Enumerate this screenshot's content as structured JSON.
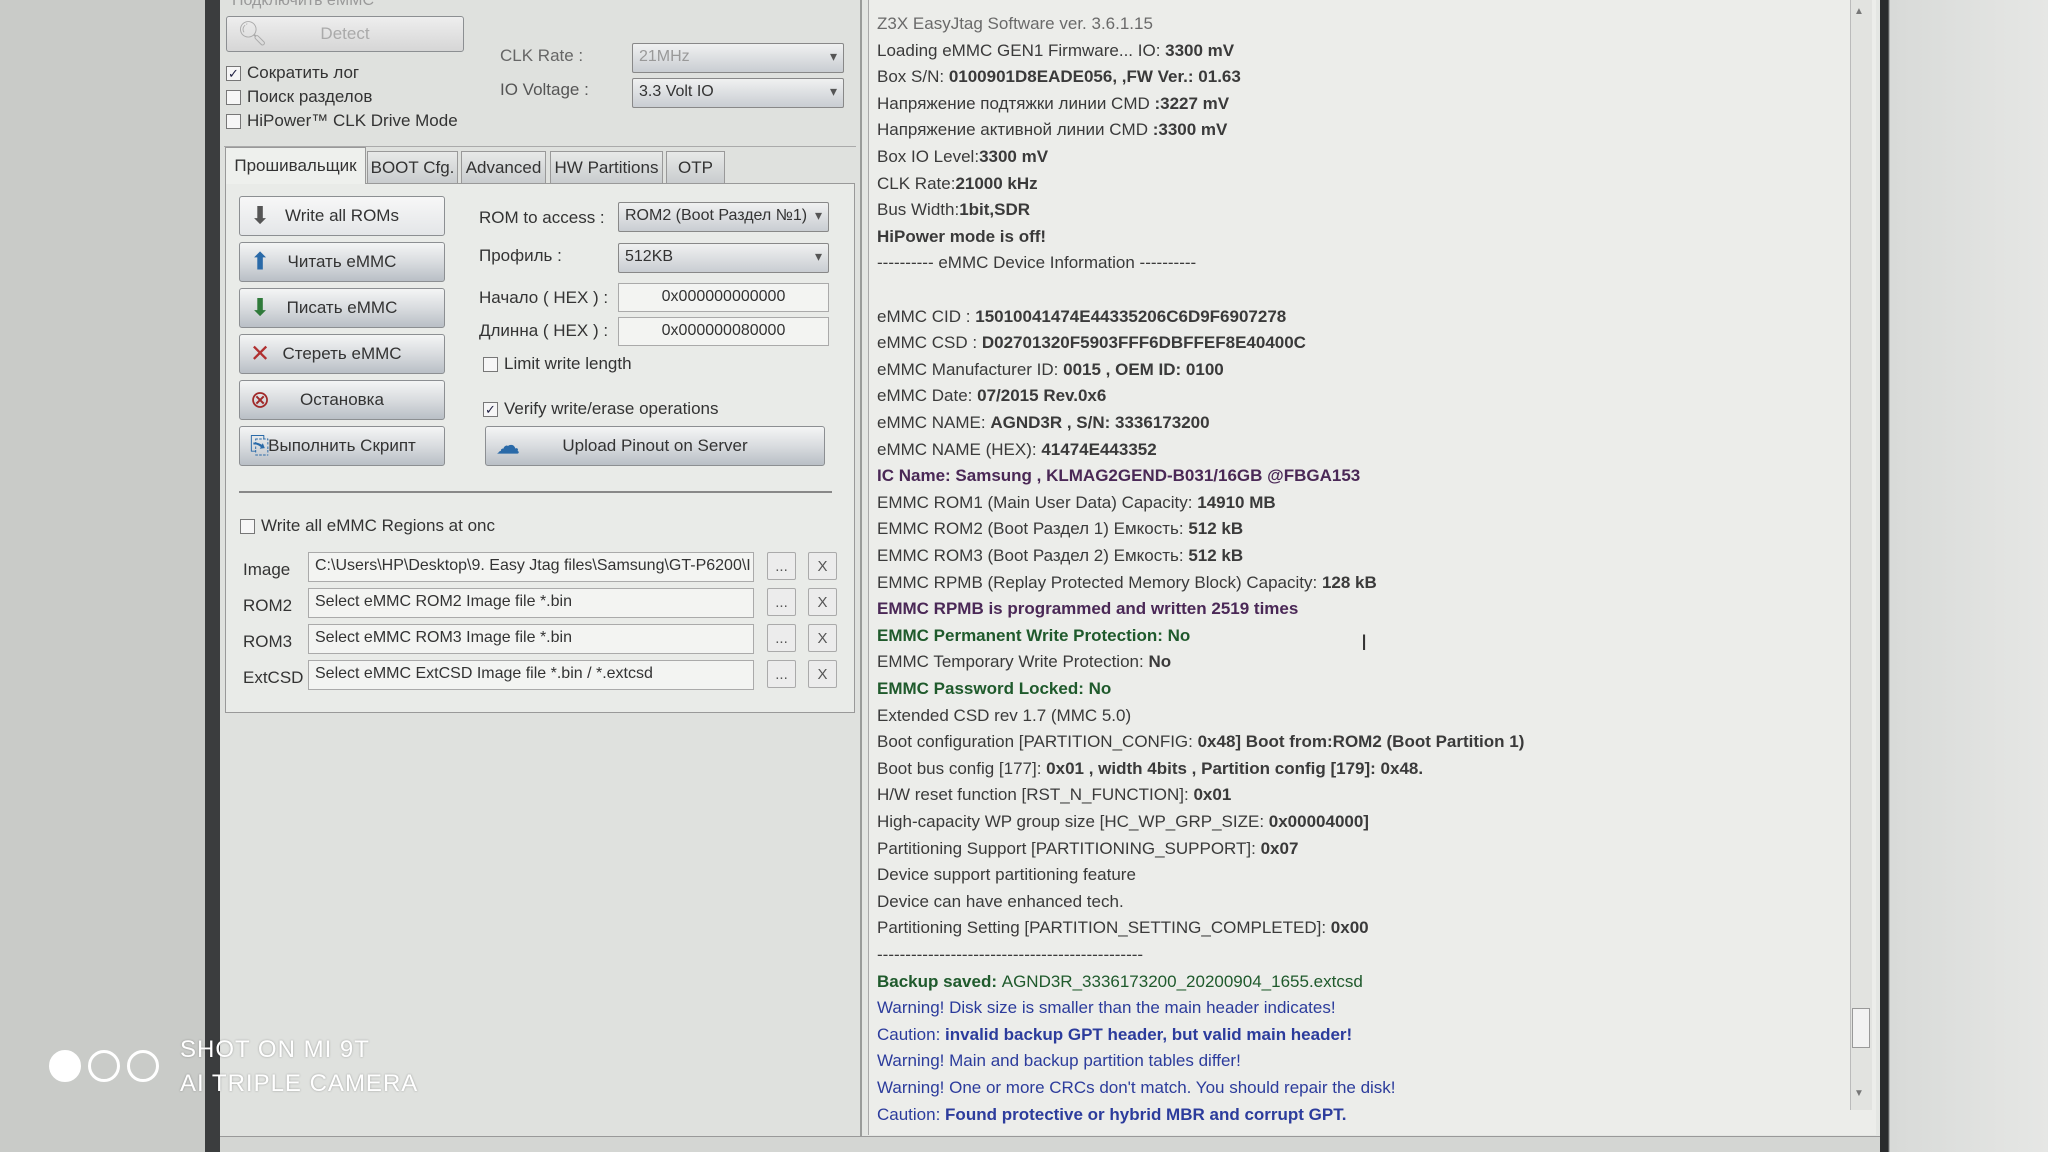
{
  "connect_group": {
    "title": "Подключить eMMC",
    "detect_label": "Detect",
    "checkboxes": [
      {
        "label": "Сократить лог",
        "checked": true
      },
      {
        "label": "Поиск разделов",
        "checked": false
      },
      {
        "label": "HiPower™ CLK Drive Mode",
        "checked": false
      }
    ],
    "clk_rate_label": "CLK Rate :",
    "clk_rate_value": "21MHz",
    "io_voltage_label": "IO Voltage :",
    "io_voltage_value": "3.3 Volt IO"
  },
  "tabs": [
    "Прошивальщик",
    "BOOT Cfg.",
    "Advanced",
    "HW Partitions",
    "OTP"
  ],
  "active_tab": "Прошивальщик",
  "actions": [
    {
      "label": "Write all ROMs",
      "icon": "download-arrow-icon"
    },
    {
      "label": "Читать eMMC",
      "icon": "upload-arrow-icon"
    },
    {
      "label": "Писать eMMC",
      "icon": "download-arrow-icon"
    },
    {
      "label": "Стереть eMMC",
      "icon": "red-x-icon"
    },
    {
      "label": "Остановка",
      "icon": "stop-circle-icon"
    },
    {
      "label": "Выполнить Скрипт",
      "icon": "script-icon"
    }
  ],
  "params": {
    "rom_label": "ROM to access :",
    "rom_value": "ROM2 (Boot Раздел №1)",
    "profile_label": "Профиль :",
    "profile_value": "512KB",
    "start_label": "Начало ( HEX ) :",
    "start_value": "0x000000000000",
    "length_label": "Длинна ( HEX ) :",
    "length_value": "0x000000080000",
    "limit_label": "Limit write length",
    "limit_checked": false,
    "verify_label": "Verify write/erase operations",
    "verify_checked": true,
    "upload_label": "Upload Pinout on Server"
  },
  "regions": {
    "write_all_label": "Write all eMMC Regions at onc",
    "write_all_checked": false,
    "browse_label": "...",
    "clear_label": "X",
    "rows": [
      {
        "label": "Image",
        "value": "C:\\Users\\HP\\Desktop\\9. Easy Jtag files\\Samsung\\GT-P6200\\I"
      },
      {
        "label": "ROM2",
        "value": "Select eMMC ROM2 Image file *.bin"
      },
      {
        "label": "ROM3",
        "value": "Select eMMC ROM3 Image file *.bin"
      },
      {
        "label": "ExtCSD",
        "value": "Select eMMC ExtCSD Image file *.bin / *.extcsd"
      }
    ]
  },
  "colors": {
    "default": "#3a3a3a",
    "title": "#6a6a6a",
    "purple": "#4a2856",
    "green": "#1f5a2c",
    "blue": "#2c3c9c"
  },
  "log": [
    {
      "c": "title",
      "s": [
        [
          "Z3X EasyJtag Software ver. 3.6.1.15",
          0
        ]
      ]
    },
    {
      "s": [
        [
          "Loading eMMC GEN1 Firmware... IO: ",
          0
        ],
        [
          "3300 mV",
          1
        ]
      ]
    },
    {
      "s": [
        [
          "Box S/N: ",
          0
        ],
        [
          "0100901D8EADE056, ,FW Ver.: 01.63",
          1
        ]
      ]
    },
    {
      "s": [
        [
          "Напряжение подтяжки линии CMD ",
          0
        ],
        [
          ":3227 mV",
          1
        ]
      ]
    },
    {
      "s": [
        [
          "Напряжение активной линии CMD ",
          0
        ],
        [
          ":3300 mV",
          1
        ]
      ]
    },
    {
      "s": [
        [
          "Box IO Level:",
          0
        ],
        [
          "3300 mV",
          1
        ]
      ]
    },
    {
      "s": [
        [
          "CLK Rate:",
          0
        ],
        [
          "21000 kHz",
          1
        ]
      ]
    },
    {
      "s": [
        [
          "Bus Width:",
          0
        ],
        [
          "1bit,SDR",
          1
        ]
      ]
    },
    {
      "s": [
        [
          "HiPower mode is off!",
          1
        ]
      ]
    },
    {
      "s": [
        [
          "---------- eMMC Device Information ----------",
          0
        ]
      ]
    },
    {
      "s": []
    },
    {
      "s": [
        [
          "eMMC CID : ",
          0
        ],
        [
          "15010041474E44335206C6D9F6907278",
          1
        ]
      ]
    },
    {
      "s": [
        [
          "eMMC CSD : ",
          0
        ],
        [
          "D02701320F5903FFF6DBFFEF8E40400C",
          1
        ]
      ]
    },
    {
      "s": [
        [
          "eMMC Manufacturer ID: ",
          0
        ],
        [
          "0015 , OEM ID: 0100",
          1
        ]
      ]
    },
    {
      "s": [
        [
          "eMMC Date: ",
          0
        ],
        [
          "07/2015  Rev.0x6",
          1
        ]
      ]
    },
    {
      "s": [
        [
          "eMMC NAME: ",
          0
        ],
        [
          "AGND3R , S/N: 3336173200",
          1
        ]
      ]
    },
    {
      "s": [
        [
          "eMMC NAME (HEX): ",
          0
        ],
        [
          "41474E443352",
          1
        ]
      ]
    },
    {
      "c": "purple",
      "s": [
        [
          "IC Name: Samsung , KLMAG2GEND-B031/16GB @FBGA153",
          1
        ]
      ]
    },
    {
      "s": [
        [
          "EMMC ROM1 (Main User Data)   Capacity: ",
          0
        ],
        [
          "14910 MB",
          1
        ]
      ]
    },
    {
      "s": [
        [
          "EMMC ROM2 (Boot Раздел 1) Емкость: ",
          0
        ],
        [
          "512 kB",
          1
        ]
      ]
    },
    {
      "s": [
        [
          "EMMC ROM3 (Boot Раздел 2) Емкость: ",
          0
        ],
        [
          "512 kB",
          1
        ]
      ]
    },
    {
      "s": [
        [
          "EMMC RPMB (Replay Protected Memory Block) Capacity: ",
          0
        ],
        [
          "128 kB",
          1
        ]
      ]
    },
    {
      "c": "purple",
      "s": [
        [
          "EMMC RPMB is programmed and written 2519 times",
          1
        ]
      ]
    },
    {
      "c": "green",
      "s": [
        [
          "EMMC Permanent Write Protection: No",
          1
        ]
      ]
    },
    {
      "s": [
        [
          "EMMC Temporary Write Protection: ",
          0
        ],
        [
          "No",
          1
        ]
      ]
    },
    {
      "c": "green",
      "s": [
        [
          "EMMC Password Locked: No",
          1
        ]
      ]
    },
    {
      "s": [
        [
          "  Extended CSD rev 1.7 (MMC 5.0)",
          0
        ]
      ]
    },
    {
      "s": [
        [
          "Boot configuration [PARTITION_CONFIG: ",
          0
        ],
        [
          "0x48] Boot from:ROM2 (Boot Partition 1)",
          1
        ]
      ]
    },
    {
      "s": [
        [
          "Boot bus config [177]: ",
          0
        ],
        [
          "0x01 , width 4bits  , Partition config [179]: 0x48.",
          1
        ]
      ]
    },
    {
      "s": [
        [
          "H/W reset function [RST_N_FUNCTION]: ",
          0
        ],
        [
          "0x01",
          1
        ]
      ]
    },
    {
      "s": [
        [
          "High-capacity WP group size [HC_WP_GRP_SIZE: ",
          0
        ],
        [
          "0x00004000]",
          1
        ]
      ]
    },
    {
      "s": [
        [
          "Partitioning Support [PARTITIONING_SUPPORT]: ",
          0
        ],
        [
          "0x07",
          1
        ]
      ]
    },
    {
      "s": [
        [
          " Device support partitioning feature",
          0
        ]
      ]
    },
    {
      "s": [
        [
          " Device can have enhanced tech.",
          0
        ]
      ]
    },
    {
      "s": [
        [
          "Partitioning Setting [PARTITION_SETTING_COMPLETED]: ",
          0
        ],
        [
          "0x00",
          1
        ]
      ]
    },
    {
      "s": [
        [
          "-----------------------------------------------",
          0
        ]
      ]
    },
    {
      "c": "green",
      "s": [
        [
          "Backup saved: ",
          1
        ],
        [
          "AGND3R_3336173200_20200904_1655.extcsd",
          0
        ]
      ]
    },
    {
      "c": "blue",
      "s": [
        [
          "Warning! Disk size is smaller than the main header indicates!",
          0
        ]
      ]
    },
    {
      "c": "blue",
      "s": [
        [
          "Caution: ",
          0
        ],
        [
          "invalid backup GPT header, but valid main header!",
          1
        ]
      ]
    },
    {
      "c": "blue",
      "s": [
        [
          "Warning! Main and backup partition tables differ!",
          0
        ]
      ]
    },
    {
      "c": "blue",
      "s": [
        [
          "Warning! One or more CRCs don't match. You should repair the disk!",
          0
        ]
      ]
    },
    {
      "c": "blue",
      "s": [
        [
          "Caution: ",
          0
        ],
        [
          "Found protective or hybrid MBR and corrupt GPT.",
          1
        ]
      ]
    }
  ],
  "watermark": {
    "line1": "SHOT ON MI 9T",
    "line2": "AI TRIPLE CAMERA"
  }
}
